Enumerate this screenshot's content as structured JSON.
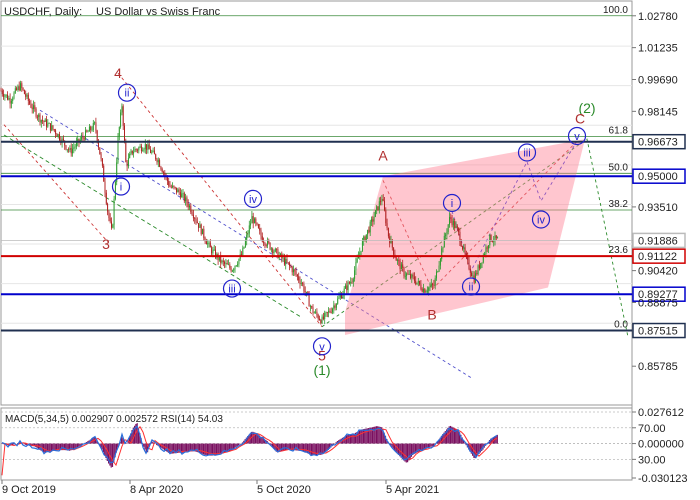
{
  "chart_data": {
    "type": "candlestick",
    "symbol": "USDCHF",
    "timeframe": "Daily",
    "description": "US Dollar vs Swiss Franc",
    "title_parts": [
      "USDCHF, Daily:",
      "US Dollar vs Swiss Franc"
    ],
    "price_range": [
      0.84,
      1.034
    ],
    "y_ticks": [
      "1.02780",
      "1.01235",
      "0.99690",
      "0.98145",
      "0.96673",
      "0.95000",
      "0.93510",
      "0.91886",
      "0.91122",
      "0.90420",
      "0.89277",
      "0.88875",
      "0.87515",
      "0.85785"
    ],
    "x_ticks": [
      "9 Oct 2019",
      "8 Apr 2020",
      "5 Oct 2020",
      "5 Apr 2021"
    ],
    "path": [
      [
        0,
        0.992
      ],
      [
        10,
        0.987
      ],
      [
        20,
        0.994
      ],
      [
        30,
        0.985
      ],
      [
        40,
        0.978
      ],
      [
        55,
        0.972
      ],
      [
        70,
        0.962
      ],
      [
        85,
        0.97
      ],
      [
        95,
        0.975
      ],
      [
        102,
        0.955
      ],
      [
        108,
        0.932
      ],
      [
        112,
        0.922
      ],
      [
        118,
        0.968
      ],
      [
        122,
        0.985
      ],
      [
        126,
        0.955
      ],
      [
        132,
        0.962
      ],
      [
        145,
        0.965
      ],
      [
        158,
        0.958
      ],
      [
        170,
        0.945
      ],
      [
        180,
        0.942
      ],
      [
        190,
        0.935
      ],
      [
        200,
        0.925
      ],
      [
        210,
        0.915
      ],
      [
        222,
        0.908
      ],
      [
        232,
        0.905
      ],
      [
        242,
        0.912
      ],
      [
        252,
        0.93
      ],
      [
        262,
        0.92
      ],
      [
        272,
        0.915
      ],
      [
        282,
        0.91
      ],
      [
        292,
        0.905
      ],
      [
        302,
        0.898
      ],
      [
        312,
        0.885
      ],
      [
        322,
        0.88
      ],
      [
        332,
        0.886
      ],
      [
        342,
        0.893
      ],
      [
        352,
        0.9
      ],
      [
        362,
        0.917
      ],
      [
        372,
        0.928
      ],
      [
        382,
        0.94
      ],
      [
        388,
        0.922
      ],
      [
        396,
        0.91
      ],
      [
        404,
        0.903
      ],
      [
        414,
        0.9
      ],
      [
        424,
        0.895
      ],
      [
        434,
        0.897
      ],
      [
        442,
        0.915
      ],
      [
        450,
        0.93
      ],
      [
        458,
        0.923
      ],
      [
        466,
        0.91
      ],
      [
        474,
        0.9
      ],
      [
        482,
        0.91
      ],
      [
        490,
        0.92
      ],
      [
        498,
        0.919
      ]
    ],
    "fib_levels": [
      {
        "label": "100.0",
        "price": 1.0278
      },
      {
        "label": "61.8",
        "price": 0.9692
      },
      {
        "label": "50.0",
        "price": 0.9514
      },
      {
        "label": "38.2",
        "price": 0.9336
      },
      {
        "label": "23.6",
        "price": 0.9112
      },
      {
        "label": "0.0",
        "price": 0.8752
      }
    ],
    "horizontal_levels": [
      {
        "label": "0.96673",
        "price": 0.96673,
        "color": "#203050"
      },
      {
        "label": "0.95000",
        "price": 0.95,
        "color": "#0000cc"
      },
      {
        "label": "0.91122",
        "price": 0.91122,
        "color": "#d00000"
      },
      {
        "label": "0.89277",
        "price": 0.89277,
        "color": "#0000cc"
      },
      {
        "label": "0.87515",
        "price": 0.87515,
        "color": "#203050"
      }
    ],
    "current_price": {
      "label": "0.91886",
      "price": 0.91886
    },
    "wave_labels": [
      {
        "text": "4",
        "x": 118,
        "price": 1.0,
        "color": "#b03030",
        "circled": false
      },
      {
        "text": "3",
        "x": 106,
        "price": 0.917,
        "color": "#b03030",
        "circled": false
      },
      {
        "text": "5",
        "x": 322,
        "price": 0.863,
        "color": "#b03030",
        "circled": false
      },
      {
        "text": "(1)",
        "x": 322,
        "price": 0.856,
        "color": "#2a8a2a",
        "circled": false
      },
      {
        "text": "(2)",
        "x": 587,
        "price": 0.983,
        "color": "#2a8a2a",
        "circled": false
      },
      {
        "text": "A",
        "x": 383,
        "price": 0.96,
        "color": "#b03030",
        "circled": false
      },
      {
        "text": "B",
        "x": 432,
        "price": 0.883,
        "color": "#b03030",
        "circled": false
      },
      {
        "text": "C",
        "x": 580,
        "price": 0.978,
        "color": "#b03030",
        "circled": false
      },
      {
        "text": "ii",
        "x": 127,
        "price": 0.9905,
        "color": "#2222cc",
        "circled": true
      },
      {
        "text": "i",
        "x": 121,
        "price": 0.945,
        "color": "#2222cc",
        "circled": true
      },
      {
        "text": "iii",
        "x": 232,
        "price": 0.8955,
        "color": "#2222cc",
        "circled": true
      },
      {
        "text": "iv",
        "x": 253,
        "price": 0.939,
        "color": "#2222cc",
        "circled": true
      },
      {
        "text": "v",
        "x": 322,
        "price": 0.8675,
        "color": "#2222cc",
        "circled": true
      },
      {
        "text": "i",
        "x": 452,
        "price": 0.937,
        "color": "#2222cc",
        "circled": true
      },
      {
        "text": "ii",
        "x": 471,
        "price": 0.8965,
        "color": "#2222cc",
        "circled": true
      },
      {
        "text": "iii",
        "x": 527,
        "price": 0.9615,
        "color": "#2222cc",
        "circled": true
      },
      {
        "text": "iv",
        "x": 541,
        "price": 0.929,
        "color": "#2222cc",
        "circled": true
      },
      {
        "text": "v",
        "x": 577,
        "price": 0.9695,
        "color": "#2222cc",
        "circled": true
      }
    ],
    "indicator": {
      "label": "MACD(5,34,5) 0.002907 0.002572 RSI(14) 54.03",
      "ticks": [
        "0.027612",
        "70.00",
        "0.000000",
        "30.00",
        "-0.030123"
      ],
      "range": [
        -0.0301,
        0.0276
      ]
    }
  }
}
